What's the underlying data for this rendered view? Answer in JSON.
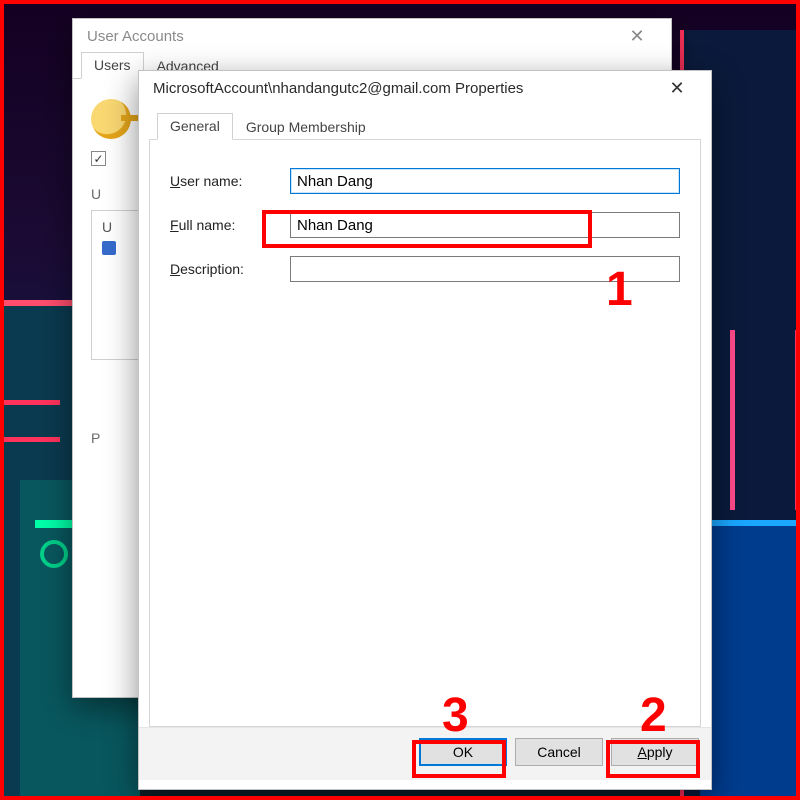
{
  "annotations": {
    "num1": "1",
    "num2": "2",
    "num3": "3"
  },
  "back_window": {
    "title": "User Accounts",
    "tabs": {
      "users": "Users",
      "advanced": "Advanced"
    },
    "checkbox_checked": "✓",
    "users_for_label_initial": "U",
    "users_caption_initial_lines": {
      "l1": "U",
      "l2": ""
    },
    "password_initial": "P"
  },
  "front_window": {
    "title": "MicrosoftAccount\\nhandangutc2@gmail.com Properties",
    "tabs": {
      "general": "General",
      "group": "Group Membership"
    },
    "fields": {
      "username": {
        "pre": "U",
        "acc": "",
        "rest": "ser name:",
        "value": "Nhan Dang"
      },
      "fullname": {
        "pre": "",
        "acc": "F",
        "rest": "ull name:",
        "value": "Nhan Dang"
      },
      "description": {
        "pre": "",
        "acc": "D",
        "rest": "escription:",
        "value": ""
      }
    },
    "buttons": {
      "ok": "OK",
      "cancel": "Cancel",
      "apply_pre": "",
      "apply_acc": "A",
      "apply_rest": "pply"
    }
  }
}
